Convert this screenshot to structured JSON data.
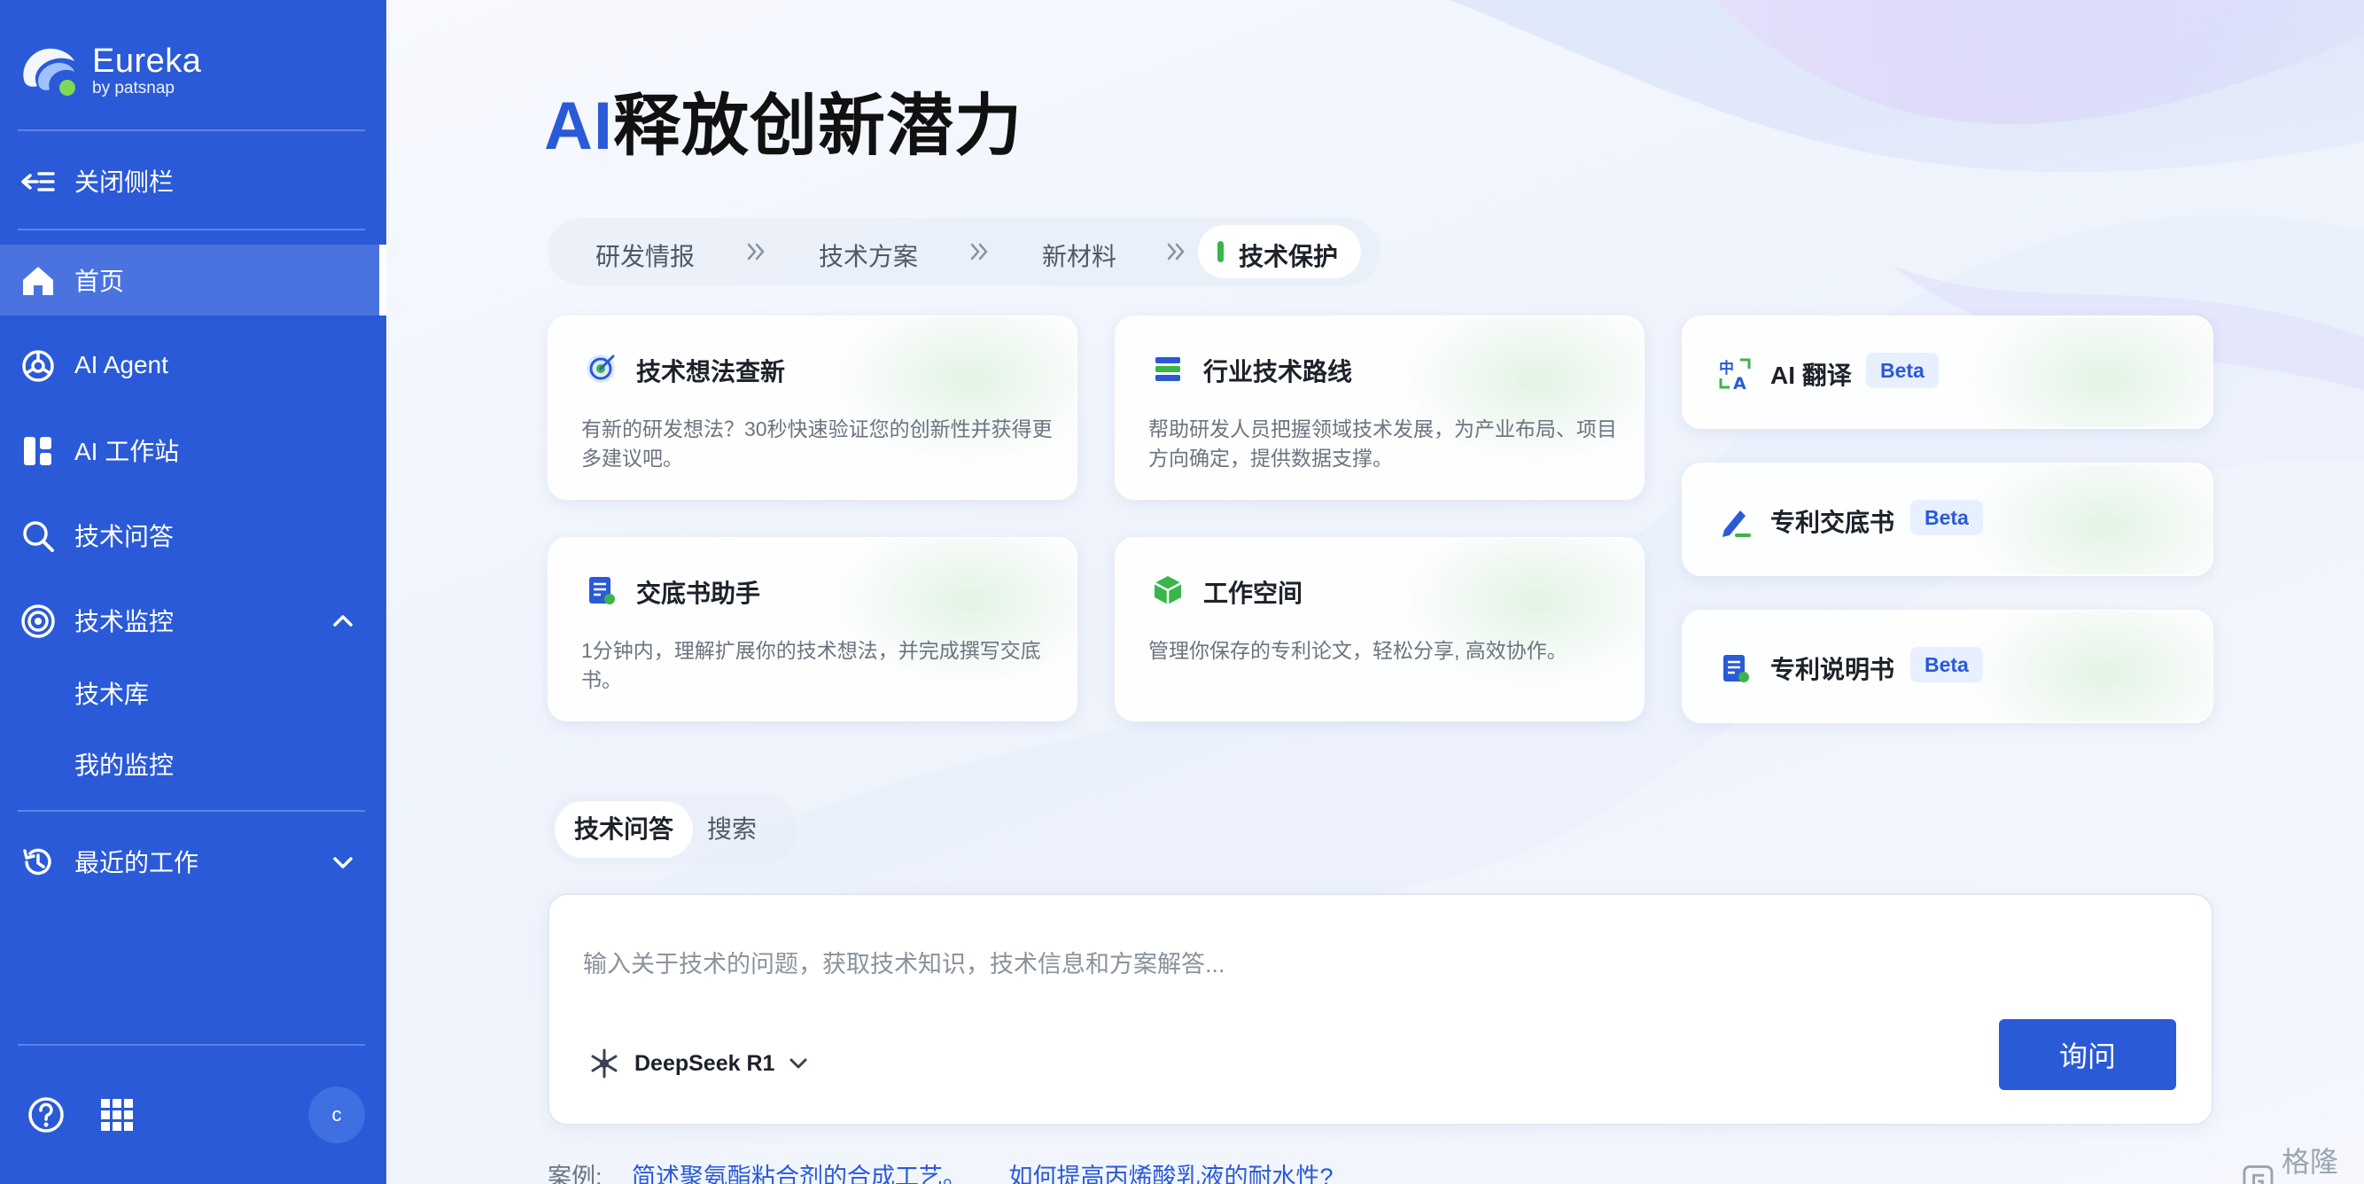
{
  "brand": {
    "name": "Eureka",
    "by": "by patsnap"
  },
  "sidebar": {
    "close_label": "关闭侧栏",
    "items": [
      {
        "label": "首页",
        "icon": "home-icon"
      },
      {
        "label": "AI Agent",
        "icon": "agent-icon"
      },
      {
        "label": "AI 工作站",
        "icon": "workstation-icon"
      },
      {
        "label": "技术问答",
        "icon": "search-icon"
      },
      {
        "label": "技术监控",
        "icon": "monitor-icon"
      },
      {
        "label": "最近的工作",
        "icon": "history-icon"
      }
    ],
    "sub_items": [
      "技术库",
      "我的监控"
    ],
    "avatar_letter": "c"
  },
  "hero": {
    "title_ai": "AI",
    "title_rest": "释放创新潜力"
  },
  "steps": [
    "研发情报",
    "技术方案",
    "新材料",
    "技术保护"
  ],
  "cards": [
    {
      "title": "技术想法查新",
      "desc": "有新的研发想法？30秒快速验证您的创新性并获得更多建议吧。"
    },
    {
      "title": "行业技术路线",
      "desc": "帮助研发人员把握领域技术发展，为产业布局、项目方向确定，提供数据支撑。"
    },
    {
      "title": "交底书助手",
      "desc": "1分钟内，理解扩展你的技术想法，并完成撰写交底书。"
    },
    {
      "title": "工作空间",
      "desc": "管理你保存的专利论文，轻松分享, 高效协作。"
    }
  ],
  "small_cards": [
    {
      "title": "AI 翻译",
      "badge": "Beta"
    },
    {
      "title": "专利交底书",
      "badge": "Beta"
    },
    {
      "title": "专利说明书",
      "badge": "Beta"
    }
  ],
  "tabs": [
    "技术问答",
    "搜索"
  ],
  "query": {
    "placeholder": "输入关于技术的问题，获取技术知识，技术信息和方案解答...",
    "model": "DeepSeek R1",
    "button": "询问"
  },
  "examples": {
    "label": "案例:",
    "items": [
      "简述聚氨酯粘合剂的合成工艺。",
      "如何提高丙烯酸乳液的耐水性?"
    ]
  },
  "watermark": "格隆汇",
  "colors": {
    "sidebar": "#2a5ad7",
    "accent": "#2a5ad7",
    "step_dot": "#3ab54a"
  }
}
